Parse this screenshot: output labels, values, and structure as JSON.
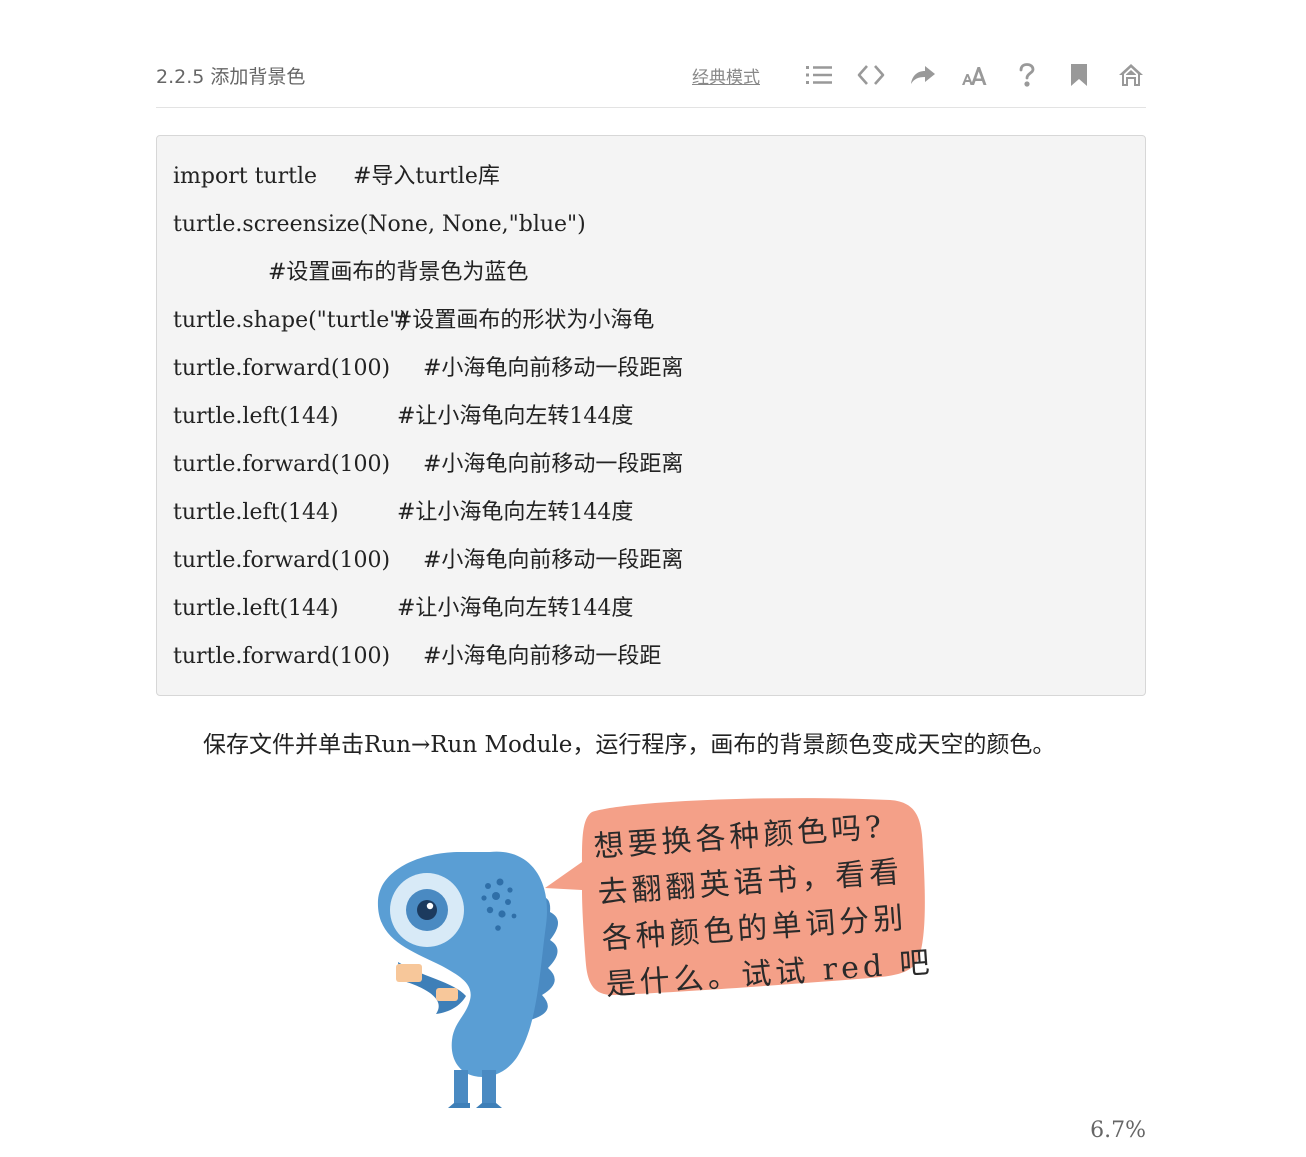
{
  "header": {
    "title": "2.2.5 添加背景色",
    "mode_label": "经典模式",
    "icons": [
      "list-icon",
      "code-icon",
      "share-icon",
      "font-size-icon",
      "help-icon",
      "bookmark-icon",
      "home-icon"
    ]
  },
  "code_lines": [
    {
      "code": "import turtle",
      "comment": "#导入turtle库"
    },
    {
      "code": "turtle.screensize(None, None,\"blue\")",
      "comment": ""
    },
    {
      "code": "",
      "comment": "#设置画布的背景色为蓝色"
    },
    {
      "code": "turtle.shape(\"turtle\")",
      "comment": "#设置画布的形状为小海龟"
    },
    {
      "code": "turtle.forward(100)",
      "comment": "#小海龟向前移动一段距离"
    },
    {
      "code": "turtle.left(144)",
      "comment": "#让小海龟向左转144度"
    },
    {
      "code": "turtle.forward(100)",
      "comment": "#小海龟向前移动一段距离"
    },
    {
      "code": "turtle.left(144)",
      "comment": "#让小海龟向左转144度"
    },
    {
      "code": "turtle.forward(100)",
      "comment": "#小海龟向前移动一段距离"
    },
    {
      "code": "turtle.left(144)",
      "comment": "#让小海龟向左转144度"
    },
    {
      "code": "turtle.forward(100)",
      "comment": "#小海龟向前移动一段距"
    }
  ],
  "caption": "保存文件并单击Run→Run Module，运行程序，画布的背景颜色变成天空的颜色。",
  "speech_bubble": {
    "lines": [
      "想要换各种颜色吗?",
      "去翻翻英语书，看看",
      "各种颜色的单词分别",
      "是什么。试试 red 吧"
    ]
  },
  "progress": "6.7%",
  "colors": {
    "code_background": "#f4f4f4",
    "bubble": "#f4a088",
    "character": "#4f93c9",
    "icon": "#999999"
  }
}
